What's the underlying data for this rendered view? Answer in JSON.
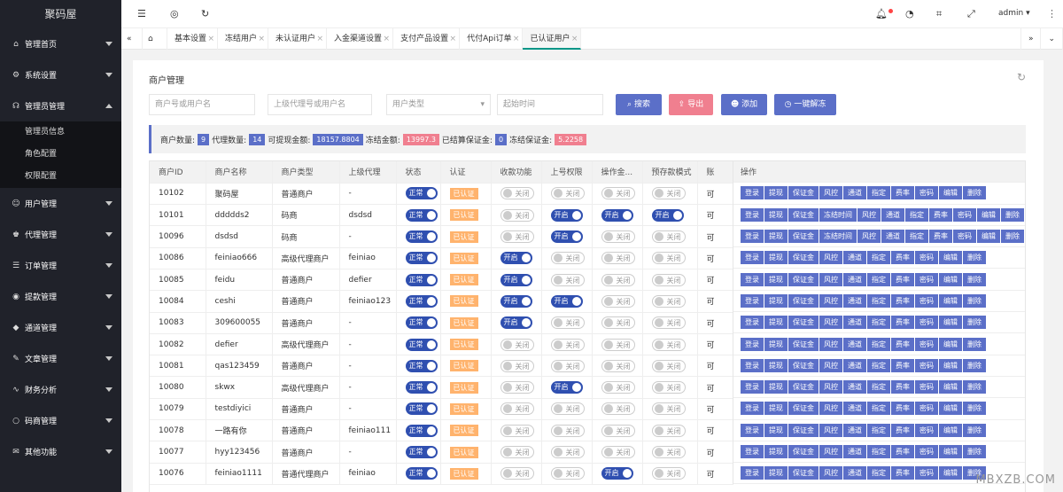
{
  "app": {
    "logo": "聚码屋"
  },
  "sidebar": {
    "items": [
      {
        "label": "管理首页",
        "icon": "home-icon",
        "glyph": "⌂"
      },
      {
        "label": "系统设置",
        "icon": "gear-icon",
        "glyph": "⚙"
      },
      {
        "label": "管理员管理",
        "icon": "headset-icon",
        "glyph": "☊"
      },
      {
        "label": "用户管理",
        "icon": "user-icon",
        "glyph": "☺"
      },
      {
        "label": "代理管理",
        "icon": "agent-icon",
        "glyph": "♚"
      },
      {
        "label": "订单管理",
        "icon": "order-icon",
        "glyph": "☰"
      },
      {
        "label": "提款管理",
        "icon": "withdraw-icon",
        "glyph": "◉"
      },
      {
        "label": "通道管理",
        "icon": "diamond-icon",
        "glyph": "◆"
      },
      {
        "label": "文章管理",
        "icon": "article-icon",
        "glyph": "✎"
      },
      {
        "label": "财务分析",
        "icon": "analysis-icon",
        "glyph": "∿"
      },
      {
        "label": "码商管理",
        "icon": "circle-icon",
        "glyph": "○"
      },
      {
        "label": "其他功能",
        "icon": "other-icon",
        "glyph": "✉"
      }
    ],
    "submenu": [
      "管理员信息",
      "角色配置",
      "权限配置"
    ]
  },
  "topbar": {
    "user": "admin"
  },
  "tabs": [
    "基本设置",
    "冻结用户",
    "未认证用户",
    "入金渠道设置",
    "支付产品设置",
    "代付Api订单",
    "已认证用户"
  ],
  "panel": {
    "title": "商户管理"
  },
  "filters": {
    "merchant": "商户号或用户名",
    "agent": "上级代理号或用户名",
    "type": "用户类型",
    "time": "起始时间"
  },
  "buttons": {
    "search": "搜索",
    "export": "导出",
    "add": "添加",
    "unfreeze": "一键解冻"
  },
  "stats": {
    "merchants_label": "商户数量:",
    "merchants": "9",
    "agents_label": "代理数量:",
    "agents": "14",
    "withdrawable_label": "可提现金额:",
    "withdrawable": "18157.8804",
    "frozen_label": "冻结金额:",
    "frozen": "13997.3",
    "settled_label": "已结算保证金:",
    "settled": "0",
    "deposit_label": "冻结保证金:",
    "deposit": "5.2258"
  },
  "table": {
    "headers": [
      "商户ID",
      "商户名称",
      "商户类型",
      "上级代理",
      "状态",
      "认证",
      "收款功能",
      "上号权限",
      "操作金...",
      "预存款模式",
      "账"
    ],
    "ops_header": "操作",
    "rows": [
      {
        "id": "10102",
        "name": "聚码屋",
        "type": "普通商户",
        "agent": "-",
        "status": "正常",
        "auth": "已认证",
        "recv": "关闭",
        "login": "关闭",
        "opmoney": "关闭",
        "prestore": "关闭",
        "acc": "可",
        "ops": [
          "登录",
          "提现",
          "保证金",
          "风控",
          "通道",
          "指定",
          "费率",
          "密码",
          "编辑",
          "删除"
        ]
      },
      {
        "id": "10101",
        "name": "ddddds2",
        "type": "码商",
        "agent": "dsdsd",
        "status": "正常",
        "auth": "已认证",
        "recv": "关闭",
        "login": "开启",
        "opmoney": "开启",
        "prestore": "开启",
        "acc": "可",
        "ops": [
          "登录",
          "提现",
          "保证金",
          "冻结时间",
          "风控",
          "通道",
          "指定",
          "费率",
          "密码",
          "编辑",
          "删除"
        ]
      },
      {
        "id": "10096",
        "name": "dsdsd",
        "type": "码商",
        "agent": "-",
        "status": "正常",
        "auth": "已认证",
        "recv": "关闭",
        "login": "开启",
        "opmoney": "关闭",
        "prestore": "关闭",
        "acc": "可",
        "ops": [
          "登录",
          "提现",
          "保证金",
          "冻结时间",
          "风控",
          "通道",
          "指定",
          "费率",
          "密码",
          "编辑",
          "删除"
        ]
      },
      {
        "id": "10086",
        "name": "feiniao666",
        "type": "高级代理商户",
        "agent": "feiniao",
        "status": "正常",
        "auth": "已认证",
        "recv": "开启",
        "login": "关闭",
        "opmoney": "关闭",
        "prestore": "关闭",
        "acc": "可",
        "ops": [
          "登录",
          "提现",
          "保证金",
          "风控",
          "通道",
          "指定",
          "费率",
          "密码",
          "编辑",
          "删除"
        ]
      },
      {
        "id": "10085",
        "name": "feidu",
        "type": "普通商户",
        "agent": "defier",
        "status": "正常",
        "auth": "已认证",
        "recv": "开启",
        "login": "关闭",
        "opmoney": "关闭",
        "prestore": "关闭",
        "acc": "可",
        "ops": [
          "登录",
          "提现",
          "保证金",
          "风控",
          "通道",
          "指定",
          "费率",
          "密码",
          "编辑",
          "删除"
        ]
      },
      {
        "id": "10084",
        "name": "ceshi",
        "type": "普通商户",
        "agent": "feiniao123",
        "status": "正常",
        "auth": "已认证",
        "recv": "开启",
        "login": "开启",
        "opmoney": "关闭",
        "prestore": "关闭",
        "acc": "可",
        "ops": [
          "登录",
          "提现",
          "保证金",
          "风控",
          "通道",
          "指定",
          "费率",
          "密码",
          "编辑",
          "删除"
        ]
      },
      {
        "id": "10083",
        "name": "309600055",
        "type": "普通商户",
        "agent": "-",
        "status": "正常",
        "auth": "已认证",
        "recv": "开启",
        "login": "关闭",
        "opmoney": "关闭",
        "prestore": "关闭",
        "acc": "可",
        "ops": [
          "登录",
          "提现",
          "保证金",
          "风控",
          "通道",
          "指定",
          "费率",
          "密码",
          "编辑",
          "删除"
        ]
      },
      {
        "id": "10082",
        "name": "defier",
        "type": "高级代理商户",
        "agent": "-",
        "status": "正常",
        "auth": "已认证",
        "recv": "关闭",
        "login": "关闭",
        "opmoney": "关闭",
        "prestore": "关闭",
        "acc": "可",
        "ops": [
          "登录",
          "提现",
          "保证金",
          "风控",
          "通道",
          "指定",
          "费率",
          "密码",
          "编辑",
          "删除"
        ]
      },
      {
        "id": "10081",
        "name": "qas123459",
        "type": "普通商户",
        "agent": "-",
        "status": "正常",
        "auth": "已认证",
        "recv": "关闭",
        "login": "关闭",
        "opmoney": "关闭",
        "prestore": "关闭",
        "acc": "可",
        "ops": [
          "登录",
          "提现",
          "保证金",
          "风控",
          "通道",
          "指定",
          "费率",
          "密码",
          "编辑",
          "删除"
        ]
      },
      {
        "id": "10080",
        "name": "skwx",
        "type": "高级代理商户",
        "agent": "-",
        "status": "正常",
        "auth": "已认证",
        "recv": "关闭",
        "login": "开启",
        "opmoney": "关闭",
        "prestore": "关闭",
        "acc": "可",
        "ops": [
          "登录",
          "提现",
          "保证金",
          "风控",
          "通道",
          "指定",
          "费率",
          "密码",
          "编辑",
          "删除"
        ]
      },
      {
        "id": "10079",
        "name": "testdiyici",
        "type": "普通商户",
        "agent": "-",
        "status": "正常",
        "auth": "已认证",
        "recv": "关闭",
        "login": "关闭",
        "opmoney": "关闭",
        "prestore": "关闭",
        "acc": "可",
        "ops": [
          "登录",
          "提现",
          "保证金",
          "风控",
          "通道",
          "指定",
          "费率",
          "密码",
          "编辑",
          "删除"
        ]
      },
      {
        "id": "10078",
        "name": "一路有你",
        "type": "普通商户",
        "agent": "feiniao111",
        "status": "正常",
        "auth": "已认证",
        "recv": "关闭",
        "login": "关闭",
        "opmoney": "关闭",
        "prestore": "关闭",
        "acc": "可",
        "ops": [
          "登录",
          "提现",
          "保证金",
          "风控",
          "通道",
          "指定",
          "费率",
          "密码",
          "编辑",
          "删除"
        ]
      },
      {
        "id": "10077",
        "name": "hyy123456",
        "type": "普通商户",
        "agent": "-",
        "status": "正常",
        "auth": "已认证",
        "recv": "关闭",
        "login": "关闭",
        "opmoney": "关闭",
        "prestore": "关闭",
        "acc": "可",
        "ops": [
          "登录",
          "提现",
          "保证金",
          "风控",
          "通道",
          "指定",
          "费率",
          "密码",
          "编辑",
          "删除"
        ]
      },
      {
        "id": "10076",
        "name": "feiniao1111",
        "type": "普通代理商户",
        "agent": "feiniao",
        "status": "正常",
        "auth": "已认证",
        "recv": "关闭",
        "login": "关闭",
        "opmoney": "开启",
        "prestore": "关闭",
        "acc": "可",
        "ops": [
          "登录",
          "提现",
          "保证金",
          "风控",
          "通道",
          "指定",
          "费率",
          "密码",
          "编辑",
          "删除"
        ]
      }
    ]
  },
  "watermark": "MBXZB.COM",
  "colors": {
    "sidebar": "#20222a",
    "primary": "#5b6fc8",
    "danger": "#f07f8f",
    "toggle": "#2f4fb0",
    "auth": "#ffb36d"
  }
}
